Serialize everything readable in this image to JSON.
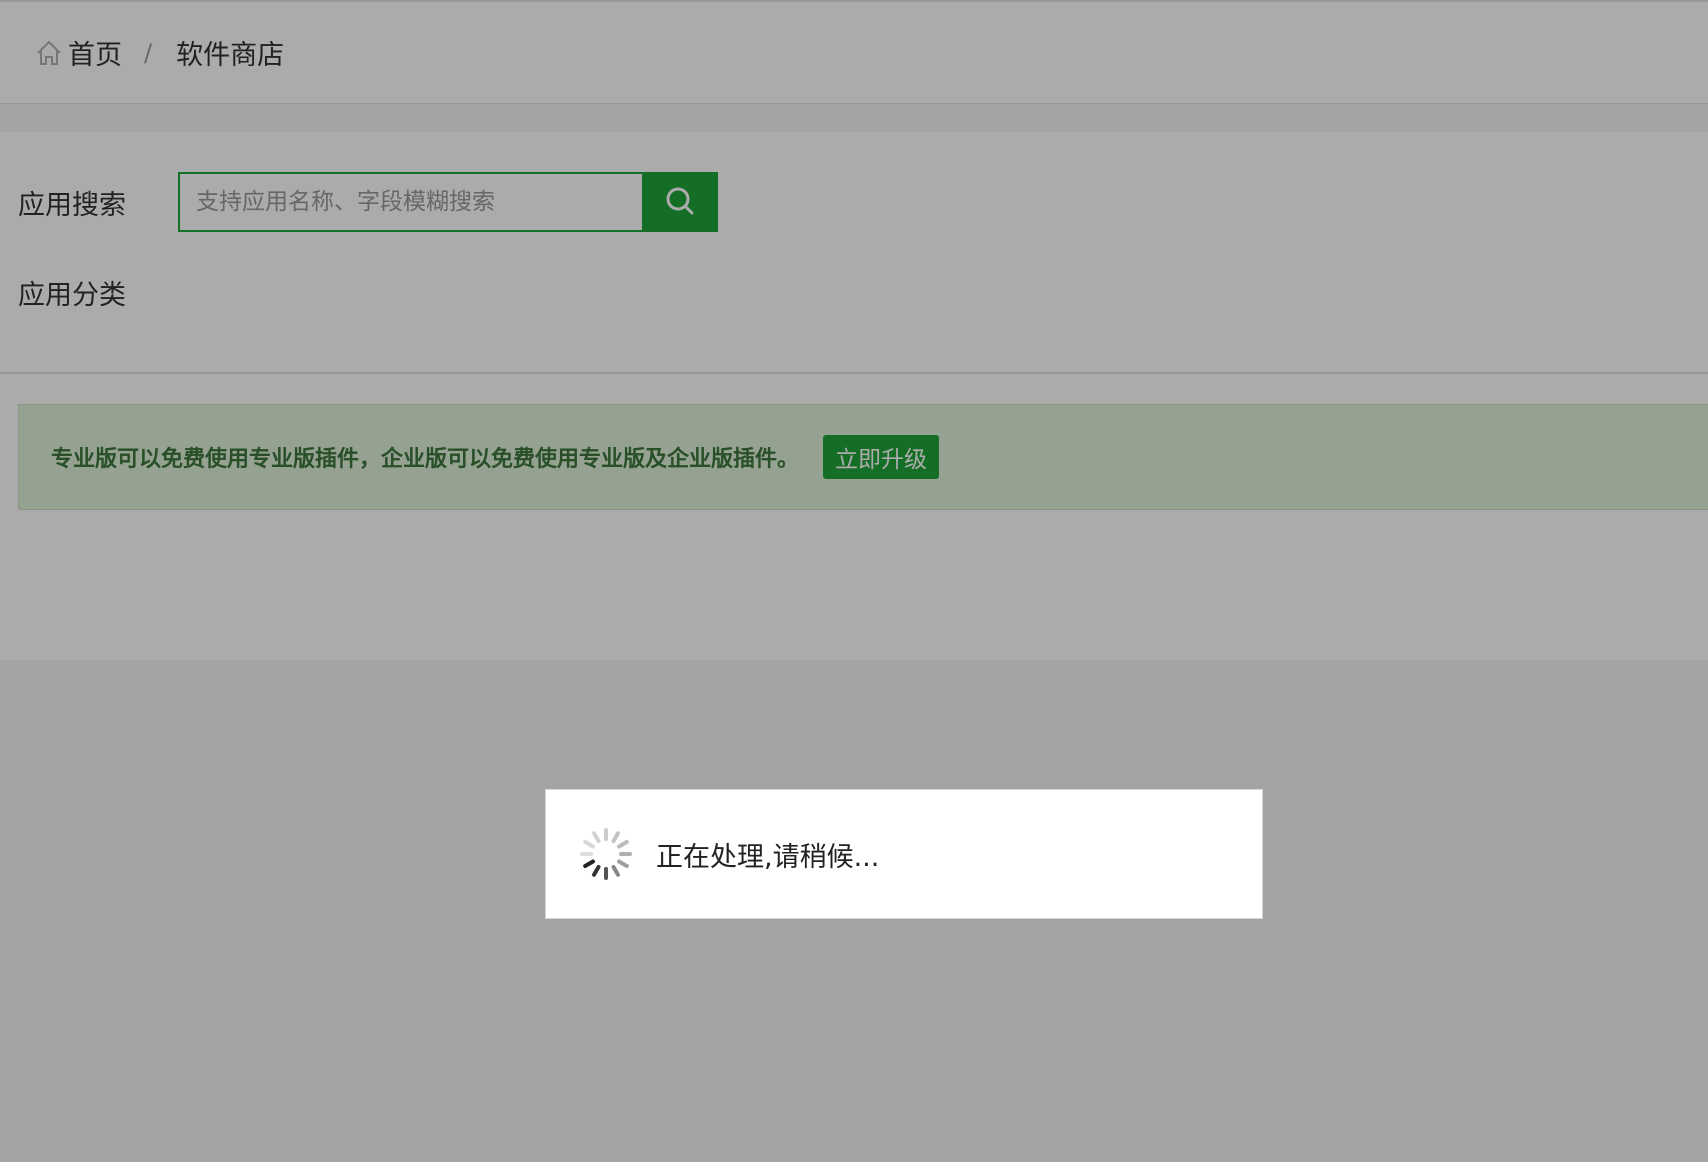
{
  "breadcrumb": {
    "home_label": "首页",
    "separator": "/",
    "current_label": "软件商店",
    "home_icon": "home-icon"
  },
  "search": {
    "label": "应用搜索",
    "placeholder": "支持应用名称、字段模糊搜索",
    "value": "",
    "button_icon": "search-icon"
  },
  "category": {
    "label": "应用分类"
  },
  "notice": {
    "text": "专业版可以免费使用专业版插件，企业版可以免费使用专业版及企业版插件。",
    "button_label": "立即升级"
  },
  "loading": {
    "text": "正在处理,请稍候...",
    "icon": "spinner-icon"
  },
  "colors": {
    "accent": "#20a53a",
    "notice_bg": "#dff0d8",
    "notice_text": "#3c763d",
    "overlay": "rgba(0,0,0,0.33)"
  }
}
